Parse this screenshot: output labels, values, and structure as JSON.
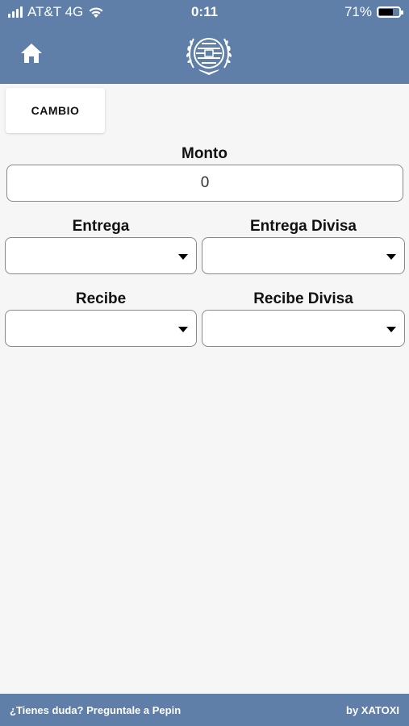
{
  "status_bar": {
    "carrier": "AT&T 4G",
    "time": "0:11",
    "battery_percent": "71%",
    "battery_level": 0.71
  },
  "header": {
    "home_icon": "home-icon",
    "logo": "laurel-emblem-logo"
  },
  "tab": {
    "label": "CAMBIO"
  },
  "form": {
    "monto_label": "Monto",
    "monto_value": "0",
    "entrega_label": "Entrega",
    "entrega_divisa_label": "Entrega Divisa",
    "recibe_label": "Recibe",
    "recibe_divisa_label": "Recibe Divisa"
  },
  "footer": {
    "help_text": "¿Tienes duda? Preguntale a Pepin",
    "credit": "by XATOXI"
  },
  "colors": {
    "brand": "#5f7ea8",
    "background": "#f6f6f6"
  }
}
